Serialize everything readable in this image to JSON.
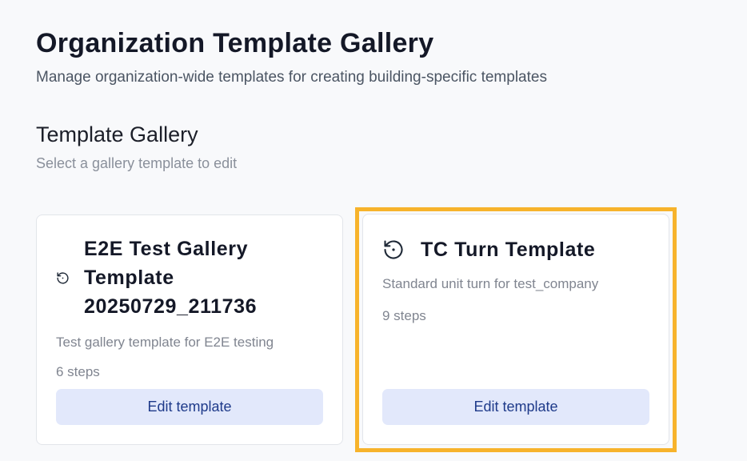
{
  "header": {
    "title": "Organization Template Gallery",
    "subtitle": "Manage organization-wide templates for creating building-specific templates"
  },
  "gallery": {
    "title": "Template Gallery",
    "subtitle": "Select a gallery template to edit",
    "cards": [
      {
        "icon": "history-icon",
        "title": "E2E Test Gallery Template 20250729_211736",
        "description": "Test gallery template for E2E testing",
        "steps": "6 steps",
        "button_label": "Edit template"
      },
      {
        "icon": "history-icon",
        "title": "TC Turn Template",
        "description": "Standard unit turn for test_company",
        "steps": "9 steps",
        "button_label": "Edit template",
        "highlighted": true
      }
    ]
  },
  "colors": {
    "highlight": "#f7b32b",
    "button_bg": "#e2e8fb",
    "button_text": "#1e3a8a"
  }
}
